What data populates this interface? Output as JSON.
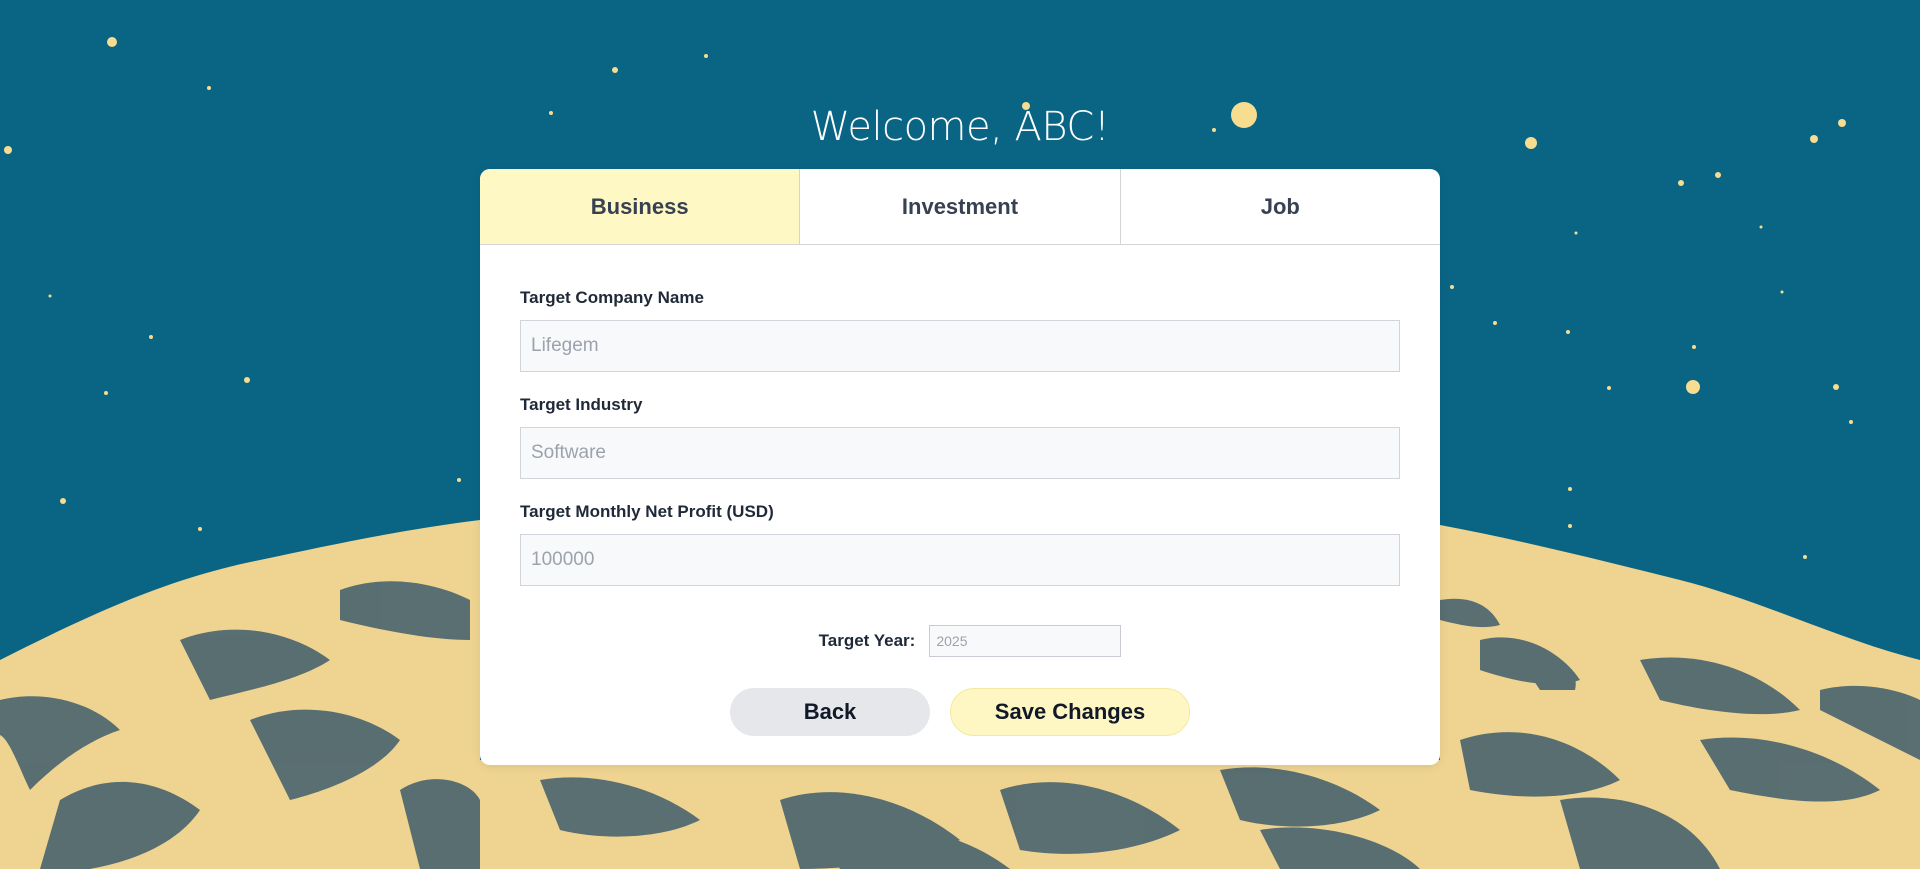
{
  "header": {
    "welcome": "Welcome, ABC!"
  },
  "tabs": [
    {
      "label": "Business",
      "active": true
    },
    {
      "label": "Investment",
      "active": false
    },
    {
      "label": "Job",
      "active": false
    }
  ],
  "form": {
    "company": {
      "label": "Target Company Name",
      "placeholder": "Lifegem"
    },
    "industry": {
      "label": "Target Industry",
      "placeholder": "Software"
    },
    "profit": {
      "label": "Target Monthly Net Profit (USD)",
      "placeholder": "100000"
    },
    "year": {
      "label": "Target Year:",
      "placeholder": "2025"
    }
  },
  "buttons": {
    "back": "Back",
    "save": "Save Changes"
  },
  "colors": {
    "background": "#0a6585",
    "active_tab": "#fef8c4",
    "sand": "#f0d58e",
    "shadow": "#3c5a6a"
  }
}
